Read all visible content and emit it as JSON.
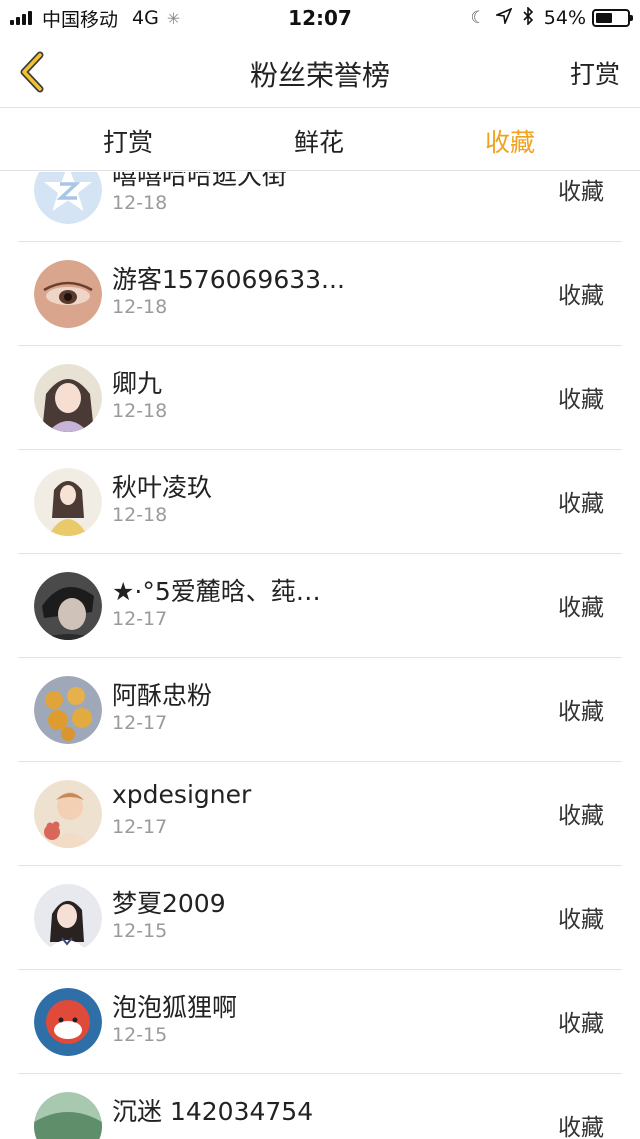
{
  "status_bar": {
    "carrier": "中国移动",
    "network": "4G",
    "time": "12:07",
    "battery_percent": "54%",
    "battery_level": 0.54
  },
  "nav": {
    "title": "粉丝荣誉榜",
    "action": "打赏"
  },
  "tabs": [
    {
      "label": "打赏",
      "active": false
    },
    {
      "label": "鲜花",
      "active": false
    },
    {
      "label": "收藏",
      "active": true
    }
  ],
  "accent_color": "#f0a21e",
  "fans": [
    {
      "name": "嘻嘻哈哈逛大街",
      "date": "12-18",
      "action": "收藏",
      "avatar": "default-avatar-icon"
    },
    {
      "name": "游客1576069633...",
      "date": "12-18",
      "action": "收藏",
      "avatar": "eye-photo"
    },
    {
      "name": "卿九",
      "date": "12-18",
      "action": "收藏",
      "avatar": "anime-girl"
    },
    {
      "name": "秋叶凌玖",
      "date": "12-18",
      "action": "收藏",
      "avatar": "anime-girl-yellow"
    },
    {
      "name": "★·°5爱麓晗、莼…",
      "date": "12-17",
      "action": "收藏",
      "avatar": "dark-portrait"
    },
    {
      "name": "阿酥忠粉",
      "date": "12-17",
      "action": "收藏",
      "avatar": "pastries"
    },
    {
      "name": "xpdesigner",
      "date": "12-17",
      "action": "收藏",
      "avatar": "baby-photo"
    },
    {
      "name": "梦夏2009",
      "date": "12-15",
      "action": "收藏",
      "avatar": "girl-photo"
    },
    {
      "name": "泡泡狐狸啊",
      "date": "12-15",
      "action": "收藏",
      "avatar": "fox-illustration"
    },
    {
      "name": "沉迷 142034754",
      "date": "",
      "action": "收藏",
      "avatar": "green-photo"
    }
  ]
}
